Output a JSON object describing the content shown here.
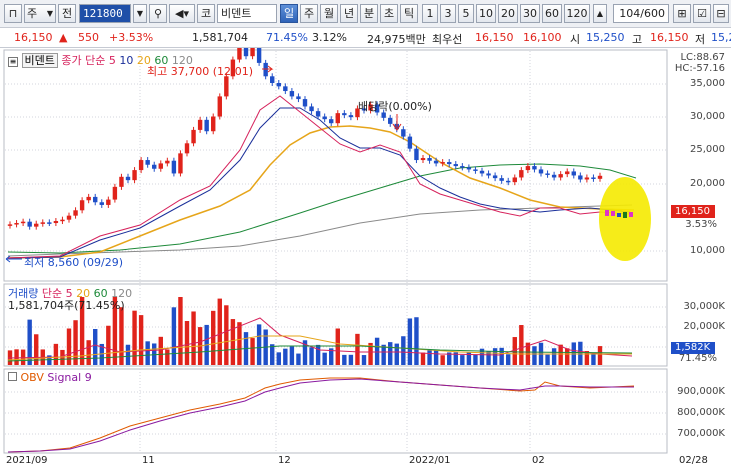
{
  "toolbar": {
    "period_select": "주",
    "prev_label": "전",
    "stock_code": "121800",
    "stock_type": "코",
    "stock_name": "비덴트",
    "periods": [
      "일",
      "주",
      "월",
      "년",
      "분",
      "초",
      "틱"
    ],
    "active_period": "일",
    "intervals": [
      "1",
      "3",
      "5",
      "10",
      "20",
      "30",
      "60",
      "120"
    ],
    "page_counter": "104/600"
  },
  "quote": {
    "price": "16,150",
    "change": "550",
    "change_pct": "+3.53%",
    "volume": "1,581,704",
    "vol_ratio": "71.45%",
    "turnover": "3.12%",
    "amount": "24,975백만",
    "best_bid_label": "최우선",
    "best_ask": "16,150",
    "best_bid": "16,100",
    "open_label": "시",
    "open": "15,250",
    "high_label": "고",
    "high": "16,150",
    "low_label": "저",
    "low": "15,2"
  },
  "price_panel": {
    "name_label": "비덴트",
    "ma_label": "종가 단순",
    "ma_periods": [
      "5",
      "10",
      "20",
      "60",
      "120"
    ],
    "high_annotation": "최고 37,700 (12/01)",
    "low_annotation": "최저 8,560 (09/29)",
    "dividend_annotation": "배당락(0.00%)",
    "lc": "LC:88.67",
    "hc": "HC:-57.16",
    "current_price": "16,150",
    "current_pct": "3.53%",
    "y_ticks": [
      "35,000",
      "30,000",
      "25,000",
      "20,000",
      "10,000"
    ]
  },
  "volume_panel": {
    "title": "거래량",
    "ma_label": "단순",
    "ma_periods": [
      "5",
      "20",
      "60",
      "120"
    ],
    "info": "1,581,704주(71.45%)",
    "y_ticks": [
      "30,000K",
      "20,000K",
      "10,000K"
    ],
    "current_tag": "1,582K",
    "current_pct": "71.45%"
  },
  "obv_panel": {
    "title": "OBV",
    "signal": "Signal 9",
    "y_ticks": [
      "900,000K",
      "800,000K",
      "700,000K"
    ]
  },
  "x_labels": [
    "2021/09",
    "11",
    "12",
    "2022/01",
    "02",
    "02/28"
  ],
  "colors": {
    "up": "#e0231b",
    "down": "#1f4fc8",
    "ma5": "#d6225c",
    "ma10": "#1a2f9a",
    "ma20": "#e6a51a",
    "ma60": "#1e8a3a",
    "ma120": "#8a8a8a",
    "highlight": "#f5ea00"
  },
  "chart_data": {
    "type": "candlestick",
    "series": [
      {
        "name": "종가",
        "values": [
          8900,
          9100,
          9300,
          8560,
          9000,
          9200,
          9100,
          9400,
          9600,
          10200,
          11000,
          12500,
          13000,
          12200,
          11800,
          12600,
          14500,
          16000,
          15500,
          17000,
          18500,
          17800,
          17200,
          18000,
          18400,
          16500,
          19500,
          21000,
          23000,
          24500,
          22800,
          25000,
          28000,
          31000,
          33500,
          36000,
          34000,
          35500,
          33000,
          31000,
          30000,
          29500,
          28800,
          28000,
          27600,
          26500,
          25800,
          25000,
          24600,
          24000,
          25500,
          25200,
          24900,
          26200,
          25900,
          26800,
          25600,
          24800,
          23900,
          23100,
          22000,
          20200,
          18500,
          18800,
          18400,
          18000,
          18200,
          17900,
          17600,
          17400,
          17100,
          16900,
          16500,
          16200,
          15800,
          15400,
          15200,
          15900,
          17000,
          17600,
          17100,
          16500,
          16300,
          15900,
          16400,
          16800,
          16200,
          15600,
          15900,
          15700,
          16150
        ]
      }
    ]
  }
}
